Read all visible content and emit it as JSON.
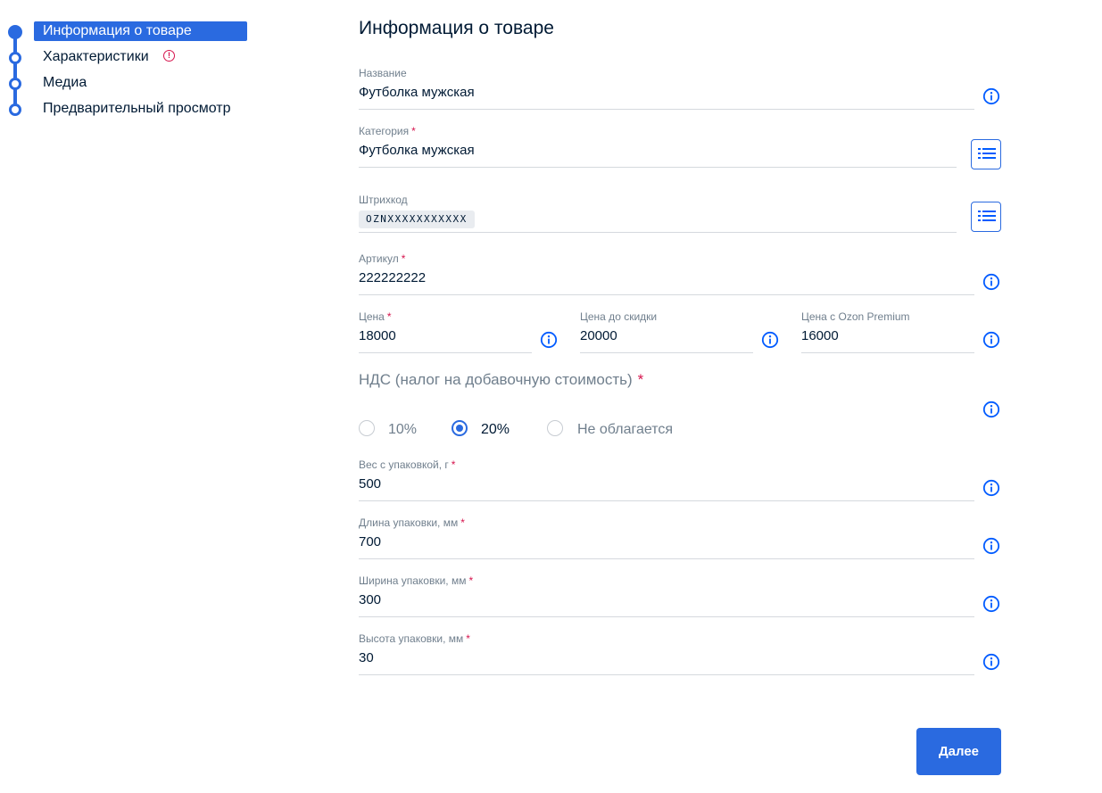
{
  "stepper": {
    "steps": [
      {
        "label": "Информация о товаре",
        "state": "active"
      },
      {
        "label": "Характеристики",
        "state": "error"
      },
      {
        "label": "Медиа",
        "state": "default"
      },
      {
        "label": "Предварительный просмотр",
        "state": "default"
      }
    ],
    "error_icon": "!"
  },
  "form": {
    "title": "Информация о товаре",
    "required_mark": "*",
    "name": {
      "label": "Название",
      "value": "Футболка мужская",
      "icon": "info-icon"
    },
    "category": {
      "label": "Категория",
      "value": "Футболка мужская",
      "icon": "list-icon"
    },
    "barcode": {
      "label": "Штрихкод",
      "value": "OZNXXXXXXXXXXX",
      "icon": "list-icon"
    },
    "article": {
      "label": "Артикул",
      "value": "222222222",
      "icon": "info-icon"
    },
    "price": {
      "label": "Цена",
      "value": "18000",
      "icon": "info-icon"
    },
    "old_price": {
      "label": "Цена до скидки",
      "value": "20000",
      "icon": "info-icon"
    },
    "premium_price": {
      "label": "Цена с Ozon Premium",
      "value": "16000",
      "icon": "info-icon"
    },
    "vat": {
      "title": "НДС (налог на добавочную стоимость)",
      "options": [
        {
          "label": "10%",
          "checked": false
        },
        {
          "label": "20%",
          "checked": true
        },
        {
          "label": "Не облагается",
          "checked": false
        }
      ],
      "icon": "info-icon"
    },
    "weight": {
      "label": "Вес с упаковкой, г",
      "value": "500",
      "icon": "info-icon"
    },
    "length": {
      "label": "Длина упаковки, мм",
      "value": "700",
      "icon": "info-icon"
    },
    "width": {
      "label": "Ширина упаковки, мм",
      "value": "300",
      "icon": "info-icon"
    },
    "height": {
      "label": "Высота упаковки, мм",
      "value": "30",
      "icon": "info-icon"
    },
    "next_label": "Далее"
  },
  "colors": {
    "accent": "#2a6ae0",
    "required": "#d6154e",
    "label": "#707f8d",
    "text": "#001a34",
    "underline": "#d5d9de"
  }
}
